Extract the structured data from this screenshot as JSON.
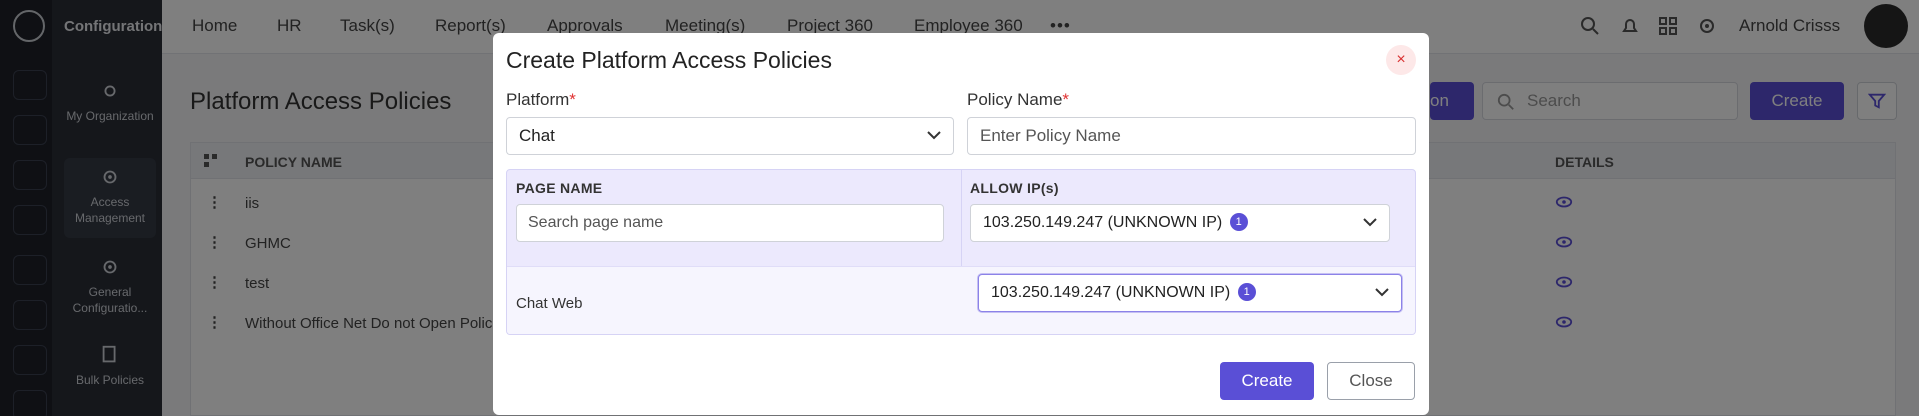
{
  "app": {
    "section_title": "Configuration",
    "sidenav": [
      {
        "label": "My Organization"
      },
      {
        "label": "Access Management"
      },
      {
        "label": "General Configuratio..."
      },
      {
        "label": "Bulk Policies"
      }
    ],
    "nav": [
      "Home",
      "HR",
      "Task(s)",
      "Report(s)",
      "Approvals",
      "Meeting(s)",
      "Project 360",
      "Employee 360"
    ],
    "more": "•••",
    "user_name": "Arnold Crisss"
  },
  "page": {
    "title": "Platform Access Policies",
    "search_placeholder": "Search",
    "create_label": "Create",
    "partial_button": "on",
    "table": {
      "columns": [
        "POLICY NAME",
        "DETAILS"
      ],
      "rows": [
        {
          "name": "iis"
        },
        {
          "name": "GHMC"
        },
        {
          "name": "test"
        },
        {
          "name": "Without Office Net Do not Open Polic"
        }
      ]
    }
  },
  "modal": {
    "title": "Create Platform Access Policies",
    "close_icon": "×",
    "platform_label": "Platform",
    "platform_value": "Chat",
    "policy_name_label": "Policy Name",
    "policy_name_placeholder": "Enter Policy Name",
    "required_mark": "*",
    "grid": {
      "col_page": "PAGE NAME",
      "col_ip": "ALLOW IP(s)",
      "page_search_placeholder": "Search page name",
      "header_ip_value": "103.250.149.247 (UNKNOWN IP)",
      "header_ip_count": "1",
      "rows": [
        {
          "page": "Chat Web",
          "ip_value": "103.250.149.247 (UNKNOWN IP)",
          "ip_count": "1"
        }
      ]
    },
    "create_label": "Create",
    "close_label": "Close"
  },
  "colors": {
    "accent": "#5a4fd6",
    "grid_bg": "#ece9fd",
    "close_icon": "#d93030"
  }
}
